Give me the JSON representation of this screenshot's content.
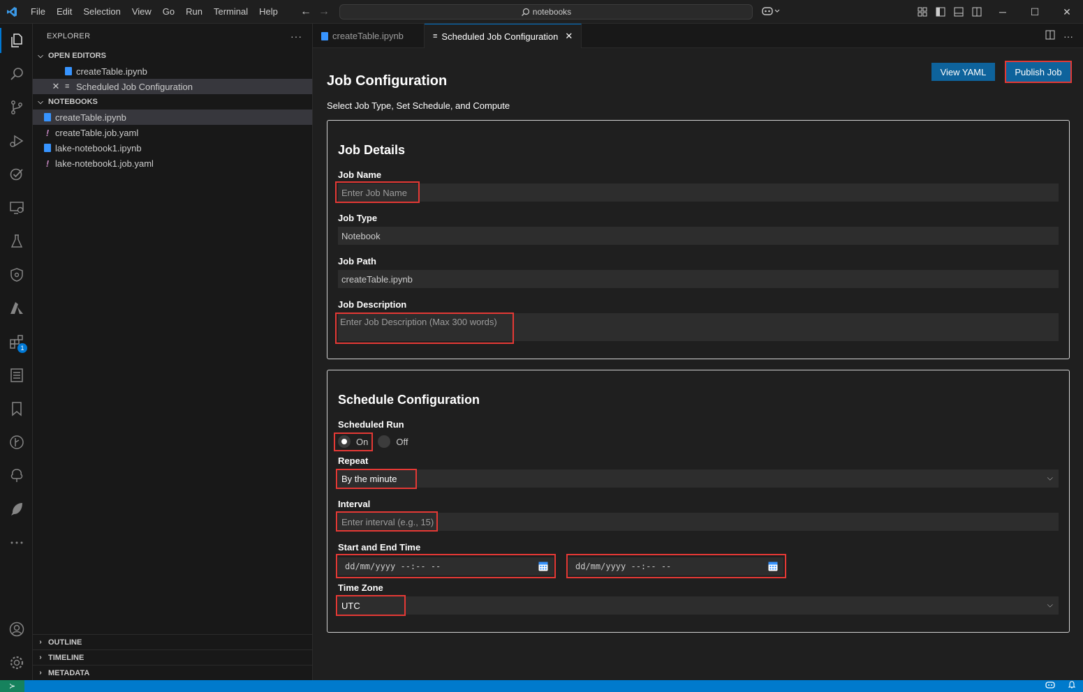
{
  "menu": [
    "File",
    "Edit",
    "Selection",
    "View",
    "Go",
    "Run",
    "Terminal",
    "Help"
  ],
  "command_center": {
    "text": "notebooks"
  },
  "sidebar": {
    "title": "EXPLORER",
    "open_editors": {
      "label": "OPEN EDITORS",
      "items": [
        {
          "name": "createTable.ipynb"
        },
        {
          "name": "Scheduled Job Configuration"
        }
      ]
    },
    "notebooks": {
      "label": "NOTEBOOKS",
      "items": [
        {
          "name": "createTable.ipynb",
          "type": "notebook"
        },
        {
          "name": "createTable.job.yaml",
          "type": "yaml"
        },
        {
          "name": "lake-notebook1.ipynb",
          "type": "notebook"
        },
        {
          "name": "lake-notebook1.job.yaml",
          "type": "yaml"
        }
      ]
    },
    "outline": "OUTLINE",
    "timeline": "TIMELINE",
    "metadata": "METADATA"
  },
  "tabs": [
    {
      "label": "createTable.ipynb",
      "active": false
    },
    {
      "label": "Scheduled Job Configuration",
      "active": true
    }
  ],
  "activity": {
    "extensions_badge": "1"
  },
  "page": {
    "title": "Job Configuration",
    "subtitle": "Select Job Type, Set Schedule, and Compute",
    "view_yaml_label": "View YAML",
    "publish_label": "Publish Job"
  },
  "job_details": {
    "title": "Job Details",
    "job_name_label": "Job Name",
    "job_name_placeholder": "Enter Job Name",
    "job_type_label": "Job Type",
    "job_type_value": "Notebook",
    "job_path_label": "Job Path",
    "job_path_value": "createTable.ipynb",
    "job_description_label": "Job Description",
    "job_description_placeholder": "Enter Job Description (Max 300 words)"
  },
  "schedule": {
    "title": "Schedule Configuration",
    "scheduled_run_label": "Scheduled Run",
    "on_label": "On",
    "off_label": "Off",
    "selected": "On",
    "repeat_label": "Repeat",
    "repeat_value": "By the minute",
    "interval_label": "Interval",
    "interval_placeholder": "Enter interval (e.g., 15)",
    "start_end_label": "Start and End Time",
    "start_value": "dd/mm/yyyy --:-- --",
    "end_value": "dd/mm/yyyy --:-- --",
    "timezone_label": "Time Zone",
    "timezone_value": "UTC"
  },
  "colors": {
    "accent": "#0078d4",
    "button": "#0e639c",
    "highlight": "#e53935",
    "statusbar": "#007acc"
  }
}
